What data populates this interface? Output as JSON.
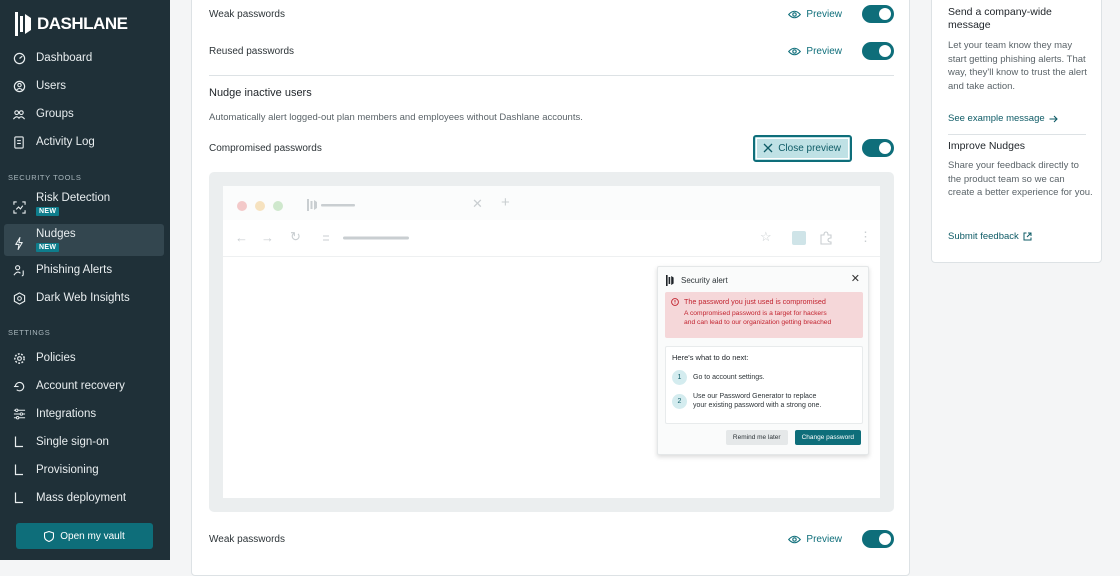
{
  "sidebar": {
    "logo": "DASHLANE",
    "nav": [
      {
        "label": "Dashboard",
        "icon": "gauge-icon"
      },
      {
        "label": "Users",
        "icon": "user-icon"
      },
      {
        "label": "Groups",
        "icon": "groups-icon"
      },
      {
        "label": "Activity Log",
        "icon": "log-icon"
      }
    ],
    "security_tools_label": "SECURITY TOOLS",
    "security_tools": [
      {
        "label": "Risk Detection",
        "badge": "NEW",
        "icon": "risk-icon"
      },
      {
        "label": "Nudges",
        "badge": "NEW",
        "icon": "lightning-icon",
        "active": true
      },
      {
        "label": "Phishing Alerts",
        "icon": "phishing-icon"
      },
      {
        "label": "Dark Web Insights",
        "icon": "darkweb-icon"
      }
    ],
    "settings_label": "SETTINGS",
    "settings": [
      {
        "label": "Policies",
        "icon": "gear-icon"
      },
      {
        "label": "Account recovery",
        "icon": "recovery-icon"
      },
      {
        "label": "Integrations",
        "icon": "sliders-icon"
      },
      {
        "label": "Single sign-on",
        "icon": "branch-icon"
      },
      {
        "label": "Provisioning",
        "icon": "branch-icon"
      },
      {
        "label": "Mass deployment",
        "icon": "branch-icon"
      }
    ],
    "open_vault": "Open my vault"
  },
  "main": {
    "rows_top": [
      {
        "label": "Weak passwords",
        "preview": "Preview"
      },
      {
        "label": "Reused passwords",
        "preview": "Preview"
      }
    ],
    "inactive_title": "Nudge inactive users",
    "inactive_desc": "Automatically alert logged-out plan members and employees without Dashlane accounts.",
    "compromised_label": "Compromised passwords",
    "close_preview": "Close preview",
    "bottom_row": {
      "label": "Weak passwords",
      "preview": "Preview"
    }
  },
  "alert_preview": {
    "title": "Security alert",
    "danger_title": "The password you just used is compromised",
    "danger_line1": "A compromised password is a target for hackers",
    "danger_line2": "and can lead to our organization getting breached",
    "next_heading": "Here's what to do next:",
    "steps": [
      {
        "num": "1",
        "line1": "Go to account settings.",
        "line2": ""
      },
      {
        "num": "2",
        "line1": "Use our Password Generator to replace",
        "line2": "your existing password with a strong one."
      }
    ],
    "remind_later": "Remind me later",
    "change_password": "Change password"
  },
  "side_panel": {
    "msg_title": "Send a company-wide message",
    "msg_text": "Let your team know they may start getting phishing alerts. That way, they'll know to trust the alert and take action.",
    "msg_link": "See example message",
    "improve_title": "Improve Nudges",
    "improve_text": "Share your feedback directly to the product team so we can create a better experience for you.",
    "improve_link": "Submit feedback"
  },
  "colors": {
    "sidebar_bg": "#1f3038",
    "accent": "#0e6e7a",
    "danger": "#c1232f"
  }
}
